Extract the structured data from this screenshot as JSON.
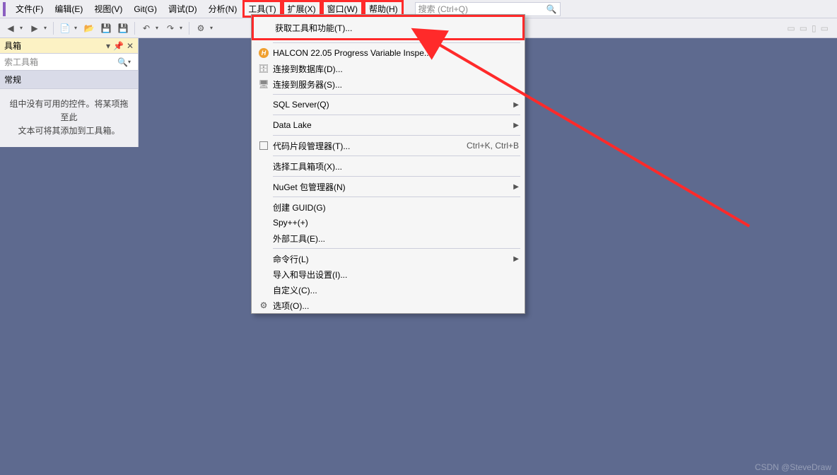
{
  "menubar": {
    "items": [
      {
        "label": "文件(F)"
      },
      {
        "label": "编辑(E)"
      },
      {
        "label": "视图(V)"
      },
      {
        "label": "Git(G)"
      },
      {
        "label": "调试(D)"
      },
      {
        "label": "分析(N)"
      },
      {
        "label": "工具(T)",
        "hl": true
      },
      {
        "label": "扩展(X)",
        "hl": true
      },
      {
        "label": "窗口(W)",
        "hl": true
      },
      {
        "label": "帮助(H)",
        "hl": true
      }
    ],
    "search_placeholder": "搜索 (Ctrl+Q)"
  },
  "sidebar": {
    "title": "具箱",
    "search_placeholder": "索工具箱",
    "category": "常规",
    "body_line1": "组中没有可用的控件。将某项拖至此",
    "body_line2": "文本可将其添加到工具箱。"
  },
  "dropdown": {
    "top_item": "获取工具和功能(T)...",
    "items": [
      {
        "icon": "halcon",
        "label": "HALCON 22.05 Progress Variable Inspe..."
      },
      {
        "icon": "db",
        "label": "连接到数据库(D)..."
      },
      {
        "icon": "server",
        "label": "连接到服务器(S)..."
      },
      {
        "sep": true
      },
      {
        "label": "SQL Server(Q)",
        "sub": true
      },
      {
        "sep": true
      },
      {
        "label": "Data Lake",
        "sub": true
      },
      {
        "sep": true
      },
      {
        "icon": "checkbox",
        "label": "代码片段管理器(T)...",
        "shortcut": "Ctrl+K, Ctrl+B"
      },
      {
        "sep": true
      },
      {
        "label": "选择工具箱项(X)..."
      },
      {
        "sep": true
      },
      {
        "label": "NuGet 包管理器(N)",
        "sub": true
      },
      {
        "sep": true
      },
      {
        "label": "创建 GUID(G)"
      },
      {
        "label": "Spy++(+)"
      },
      {
        "label": "外部工具(E)..."
      },
      {
        "sep": true
      },
      {
        "label": "命令行(L)",
        "sub": true
      },
      {
        "label": "导入和导出设置(I)..."
      },
      {
        "label": "自定义(C)..."
      },
      {
        "icon": "gear",
        "label": "选项(O)..."
      }
    ]
  },
  "watermark": "CSDN @SteveDraw"
}
